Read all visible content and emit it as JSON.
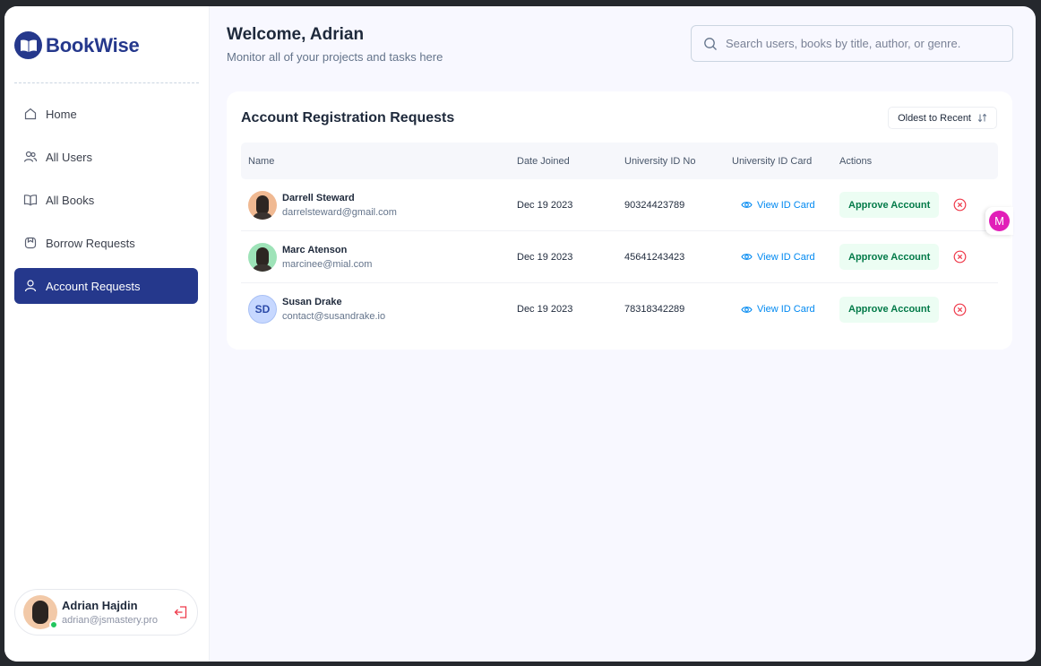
{
  "app": {
    "name": "BookWise"
  },
  "sidebar": {
    "items": [
      {
        "label": "Home",
        "icon": "home-icon",
        "active": false
      },
      {
        "label": "All Users",
        "icon": "users-icon",
        "active": false
      },
      {
        "label": "All Books",
        "icon": "book-icon",
        "active": false
      },
      {
        "label": "Borrow Requests",
        "icon": "bookmark-icon",
        "active": false
      },
      {
        "label": "Account Requests",
        "icon": "user-icon",
        "active": true
      }
    ],
    "profile": {
      "name": "Adrian Hajdin",
      "email": "adrian@jsmastery.pro",
      "status": "online"
    }
  },
  "header": {
    "title": "Welcome, Adrian",
    "subtitle": "Monitor all of your projects and tasks here",
    "search_placeholder": "Search users, books by title, author, or genre."
  },
  "card": {
    "title": "Account Registration Requests",
    "sort_label": "Oldest to Recent",
    "columns": [
      "Name",
      "Date Joined",
      "University ID No",
      "University ID Card",
      "Actions"
    ],
    "rows": [
      {
        "name": "Darrell Steward",
        "email": "darrelsteward@gmail.com",
        "date": "Dec 19 2023",
        "uid": "90324423789",
        "view_label": "View ID Card",
        "approve_label": "Approve Account",
        "avatar": "photo"
      },
      {
        "name": "Marc Atenson",
        "email": "marcinee@mial.com",
        "date": "Dec 19 2023",
        "uid": "45641243423",
        "view_label": "View ID Card",
        "approve_label": "Approve Account",
        "avatar": "photo"
      },
      {
        "name": "Susan Drake",
        "email": "contact@susandrake.io",
        "date": "Dec 19 2023",
        "uid": "78318342289",
        "view_label": "View ID Card",
        "approve_label": "Approve Account",
        "avatar": "SD"
      }
    ]
  },
  "floating_badge": {
    "letter": "M"
  },
  "colors": {
    "brand": "#25388c",
    "link": "#0089f1",
    "approve_bg": "#ecfdf3",
    "approve_text": "#027a48",
    "reject": "#ef3a4b"
  }
}
